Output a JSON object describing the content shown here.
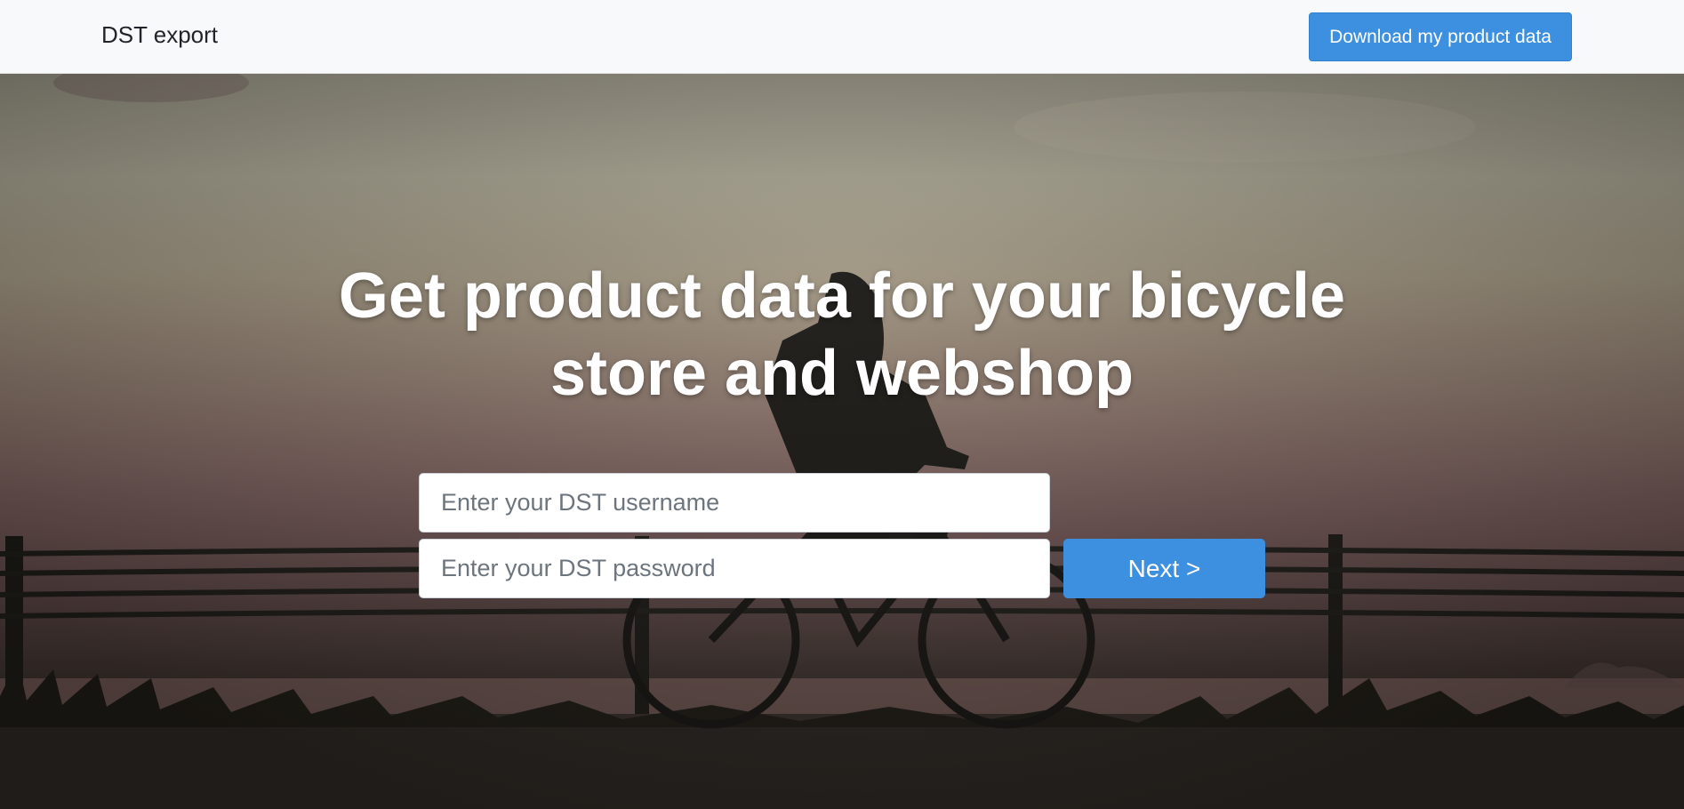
{
  "navbar": {
    "brand": "DST export",
    "download_button": "Download my product data"
  },
  "hero": {
    "headline_line1": "Get product data for your bicycle",
    "headline_line2": "store and webshop",
    "background_icon": "cyclist-silhouette-photo"
  },
  "form": {
    "username_placeholder": "Enter your DST username",
    "username_value": "",
    "password_placeholder": "Enter your DST password",
    "password_value": "",
    "next_button": "Next >"
  },
  "colors": {
    "accent": "#3d90e0",
    "navbar_bg": "#f8f9fa"
  }
}
